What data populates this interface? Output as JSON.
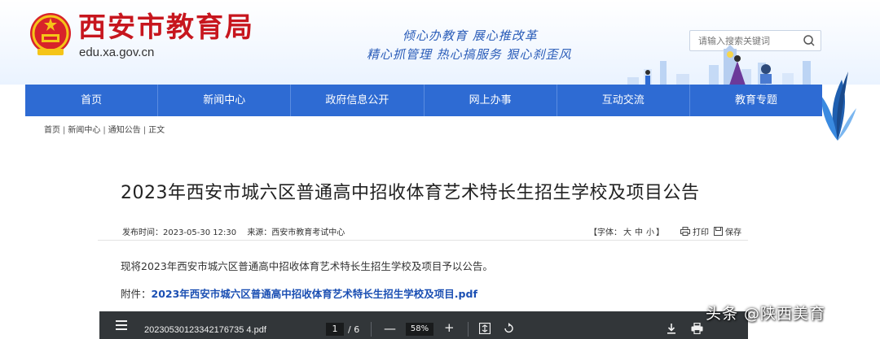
{
  "header": {
    "site_title": "西安市教育局",
    "domain": "edu.xa.gov.cn",
    "slogan_line1": "倾心办教育  展心推改革",
    "slogan_line2": "精心抓管理  热心搞服务  狠心刹歪风",
    "search_placeholder": "请输入搜索关键词",
    "emblem_icon": "national-emblem-icon",
    "search_icon": "search-icon",
    "colors": {
      "title": "#c7161e",
      "nav": "#2e6bd3",
      "slogan": "#2a5cb8"
    }
  },
  "nav": {
    "items": [
      {
        "label": "首页"
      },
      {
        "label": "新闻中心"
      },
      {
        "label": "政府信息公开"
      },
      {
        "label": "网上办事"
      },
      {
        "label": "互动交流"
      },
      {
        "label": "教育专题"
      }
    ]
  },
  "breadcrumb": {
    "items": [
      "首页",
      "新闻中心",
      "通知公告",
      "正文"
    ],
    "separator": "|"
  },
  "article": {
    "title": "2023年西安市城六区普通高中招收体育艺术特长生招生学校及项目公告",
    "publish_time": "发布时间：2023-05-30 12:30",
    "source": "来源：西安市教育考试中心",
    "font_size_label": "【字体：",
    "font_large": "大",
    "font_medium": "中",
    "font_small": "小",
    "font_size_end": "】",
    "print_label": "打印",
    "save_label": "保存",
    "body": "现将2023年西安市城六区普通高中招收体育艺术特长生招生学校及项目予以公告。",
    "attachment_prefix": "附件：",
    "attachment_name": "2023年西安市城六区普通高中招收体育艺术特长生招生学校及项目.pdf"
  },
  "pdf_viewer": {
    "file_name": "20230530123342176735 4.pdf",
    "current_page": "1",
    "total_pages": "/ 6",
    "zoom": "58%",
    "minus": "—",
    "plus": "+"
  },
  "watermark": "头条 @陕西美育"
}
